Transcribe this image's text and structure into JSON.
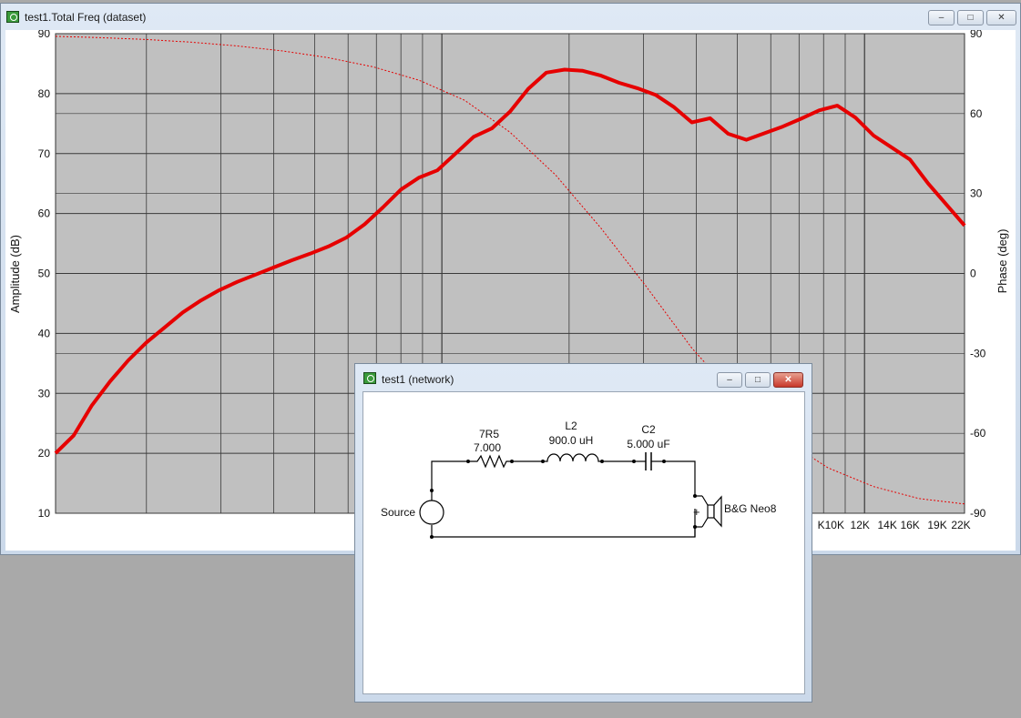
{
  "freq_window": {
    "title": "test1.Total Freq (dataset)",
    "buttons": {
      "minimize": "–",
      "maximize": "□",
      "close": "✕"
    }
  },
  "network_window": {
    "title": "test1 (network)",
    "buttons": {
      "minimize": "–",
      "maximize": "□",
      "close": "✕"
    }
  },
  "chart_data": {
    "type": "line",
    "xlabel": "",
    "ylabel": "Amplitude (dB)",
    "y2label": "Phase (deg)",
    "ylim": [
      10,
      90
    ],
    "y2lim": [
      -90,
      90
    ],
    "xscale": "log",
    "y_ticks": [
      "90",
      "80",
      "70",
      "60",
      "50",
      "40",
      "30",
      "20",
      "10"
    ],
    "y2_ticks": [
      "90",
      "60",
      "30",
      "0",
      "-30",
      "-60",
      "-90"
    ],
    "x_tick_labels": [
      "K10K",
      "12K",
      "14K",
      "16K",
      "19K",
      "22K"
    ],
    "colors": {
      "plot_bg": "#c0c0c0",
      "grid": "#3a3a3a",
      "series": "#e60000"
    },
    "series": [
      {
        "kind": "amplitude",
        "style": "solid",
        "points": [
          [
            0,
            20
          ],
          [
            0.02,
            23
          ],
          [
            0.04,
            28
          ],
          [
            0.06,
            32
          ],
          [
            0.08,
            35.5
          ],
          [
            0.1,
            38.5
          ],
          [
            0.12,
            41
          ],
          [
            0.14,
            43.5
          ],
          [
            0.16,
            45.5
          ],
          [
            0.18,
            47.2
          ],
          [
            0.2,
            48.6
          ],
          [
            0.22,
            49.8
          ],
          [
            0.24,
            51
          ],
          [
            0.26,
            52.2
          ],
          [
            0.28,
            53.3
          ],
          [
            0.3,
            54.5
          ],
          [
            0.32,
            56
          ],
          [
            0.34,
            58.2
          ],
          [
            0.36,
            61
          ],
          [
            0.38,
            64
          ],
          [
            0.4,
            66
          ],
          [
            0.42,
            67.2
          ],
          [
            0.44,
            70
          ],
          [
            0.46,
            72.8
          ],
          [
            0.48,
            74.2
          ],
          [
            0.5,
            77
          ],
          [
            0.52,
            80.8
          ],
          [
            0.54,
            83.5
          ],
          [
            0.56,
            84
          ],
          [
            0.58,
            83.8
          ],
          [
            0.6,
            83
          ],
          [
            0.62,
            81.8
          ],
          [
            0.64,
            80.9
          ],
          [
            0.66,
            79.8
          ],
          [
            0.68,
            77.8
          ],
          [
            0.7,
            75.2
          ],
          [
            0.72,
            75.9
          ],
          [
            0.74,
            73.3
          ],
          [
            0.76,
            72.3
          ],
          [
            0.78,
            73.4
          ],
          [
            0.8,
            74.5
          ],
          [
            0.82,
            75.8
          ],
          [
            0.84,
            77.2
          ],
          [
            0.86,
            78
          ],
          [
            0.88,
            76
          ],
          [
            0.9,
            73
          ],
          [
            0.92,
            71
          ],
          [
            0.94,
            69
          ],
          [
            0.96,
            65
          ],
          [
            0.98,
            61.5
          ],
          [
            1.0,
            58
          ]
        ]
      },
      {
        "kind": "phase",
        "style": "dotted",
        "points": [
          [
            0,
            89
          ],
          [
            0.05,
            88.5
          ],
          [
            0.1,
            87.8
          ],
          [
            0.15,
            86.8
          ],
          [
            0.2,
            85.4
          ],
          [
            0.25,
            83.5
          ],
          [
            0.3,
            81
          ],
          [
            0.35,
            77.5
          ],
          [
            0.4,
            72.5
          ],
          [
            0.45,
            65
          ],
          [
            0.5,
            53
          ],
          [
            0.55,
            37
          ],
          [
            0.6,
            17
          ],
          [
            0.65,
            -5
          ],
          [
            0.7,
            -28
          ],
          [
            0.75,
            -47
          ],
          [
            0.8,
            -62
          ],
          [
            0.85,
            -73
          ],
          [
            0.9,
            -80
          ],
          [
            0.95,
            -84.5
          ],
          [
            1.0,
            -86.5
          ]
        ]
      }
    ]
  },
  "schematic": {
    "r_name": "7R5",
    "r_value": "7.000",
    "l_name": "L2",
    "l_value": "900.0 uH",
    "c_name": "C2",
    "c_value": "5.000 uF",
    "source_label": "Source",
    "driver_label": "B&G Neo8",
    "plus_sign": "+"
  }
}
